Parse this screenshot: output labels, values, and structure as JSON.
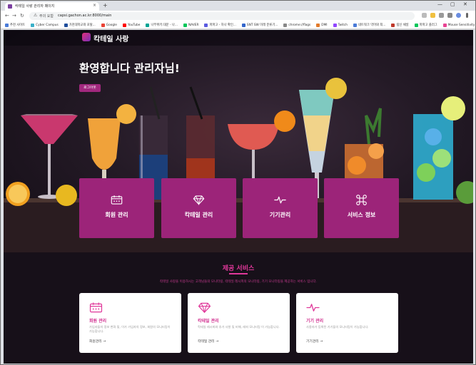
{
  "browser": {
    "tab_title": "칵테일 사랑 관리자 페이지",
    "tab_close": "×",
    "new_tab": "+",
    "window_minimize": "—",
    "window_maximize": "▢",
    "window_close": "✕",
    "nav_back": "←",
    "nav_forward": "→",
    "nav_reload": "↻",
    "url_label": "주의 요함",
    "url": "capsi.gachon.ac.kr:8000/main"
  },
  "bookmarks": [
    {
      "label": "추천 사이트",
      "color": "#4a7bd8"
    },
    {
      "label": "Cyber Campus",
      "color": "#3bb0c9"
    },
    {
      "label": "가천대학교와 포탈...",
      "color": "#1f4e9c"
    },
    {
      "label": "Google",
      "color": "#ea4335"
    },
    {
      "label": "YouTube",
      "color": "#ff0000"
    },
    {
      "label": "나무위키:대문 - 나...",
      "color": "#00a495"
    },
    {
      "label": "NAVER",
      "color": "#03c75a"
    },
    {
      "label": "파파고 - 하나 확인...",
      "color": "#5a5ae0"
    },
    {
      "label": "SNT SW 미래 분류기...",
      "color": "#3366cc"
    },
    {
      "label": "chrome://flags",
      "color": "#888888"
    },
    {
      "label": "DMI",
      "color": "#e27b2c"
    },
    {
      "label": "Twitch",
      "color": "#9146ff"
    },
    {
      "label": "네트워크 약어와 최...",
      "color": "#4a7bd8"
    },
    {
      "label": "링신 채널",
      "color": "#c0392b"
    },
    {
      "label": "파파고 플러그",
      "color": "#03c75a"
    },
    {
      "label": "Mouse Sensitivity |...",
      "color": "#e84393"
    }
  ],
  "header": {
    "brand": "칵테일 사랑"
  },
  "hero": {
    "welcome": "환영합니다 관리자님!",
    "logout_label": "로그아웃"
  },
  "menu_cards": [
    {
      "label": "회원 관리",
      "icon": "calendar-icon"
    },
    {
      "label": "칵테일 관리",
      "icon": "diamond-icon"
    },
    {
      "label": "기기관리",
      "icon": "pulse-icon"
    },
    {
      "label": "서비스 정보",
      "icon": "command-icon"
    }
  ],
  "services": {
    "title": "제공 서비스",
    "description": "칵테일 사랑을 이용하시는 고객님들의 모니터링, 칵테일 레시피의 모니터링, 기기 모니터링을 제공하는 서비스 입니다.",
    "cards": [
      {
        "name": "회원 관리",
        "text": "가입자들의 정보 변화 및, 이가 가입자의 정보, 회원의 모니터링이 가능합니다.",
        "link": "회원관리 →",
        "icon": "calendar-icon"
      },
      {
        "name": "칵테일 관리",
        "text": "칵테일 레시피와 추가 사항 및 비해, 레피 모니터링 이 가능합니다.",
        "link": "칵테일 관리 →",
        "icon": "diamond-icon"
      },
      {
        "name": "기기 관리",
        "text": "사용자가 등록된 기기들의 모니터링이 가능합니다.",
        "link": "기기관리 →",
        "icon": "pulse-icon"
      }
    ]
  },
  "colors": {
    "accent": "#9c2479",
    "service_title": "#e0389a",
    "background": "#160f1a"
  }
}
